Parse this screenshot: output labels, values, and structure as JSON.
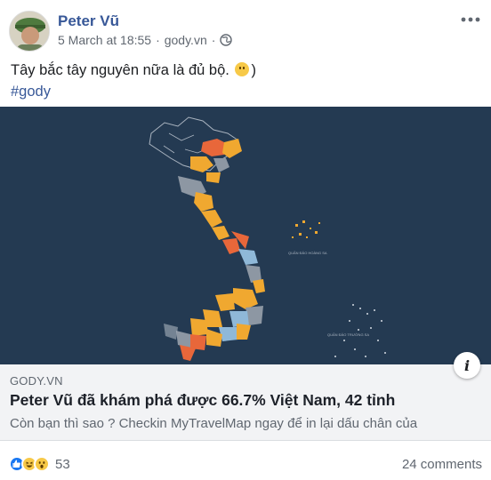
{
  "post": {
    "author": "Peter Vũ",
    "date": "5 March at 18:55",
    "separator": "·",
    "source": "gody.vn",
    "visibility_icon": "globe-icon",
    "more_icon": "more-options-icon",
    "text_line1": "Tây bắc tây nguyên nữa là đủ bộ.",
    "text_line1_end": ")",
    "hashtag": "#gody"
  },
  "link_preview": {
    "domain": "GODY.VN",
    "title": "Peter Vũ đã khám phá được 66.7% Việt Nam, 42 tỉnh",
    "description": "Còn bạn thì sao ? Checkin MyTravelMap ngay để in lại dấu chân của",
    "info_label": "i",
    "map_label_paracel": "QUẦN ĐẢO HOÀNG SA",
    "map_label_spratly": "QUẦN ĐẢO TRƯỜNG SA"
  },
  "footer": {
    "reaction_icons": [
      "like-icon",
      "haha-icon",
      "wow-icon"
    ],
    "reaction_count": "53",
    "comments": "24 comments"
  },
  "colors": {
    "link_blue": "#385898",
    "map_background": "#243a52",
    "province_orange": "#f0a830",
    "province_red": "#e8673a",
    "province_gray": "#8d97a3",
    "province_blue": "#8fb8d8"
  }
}
